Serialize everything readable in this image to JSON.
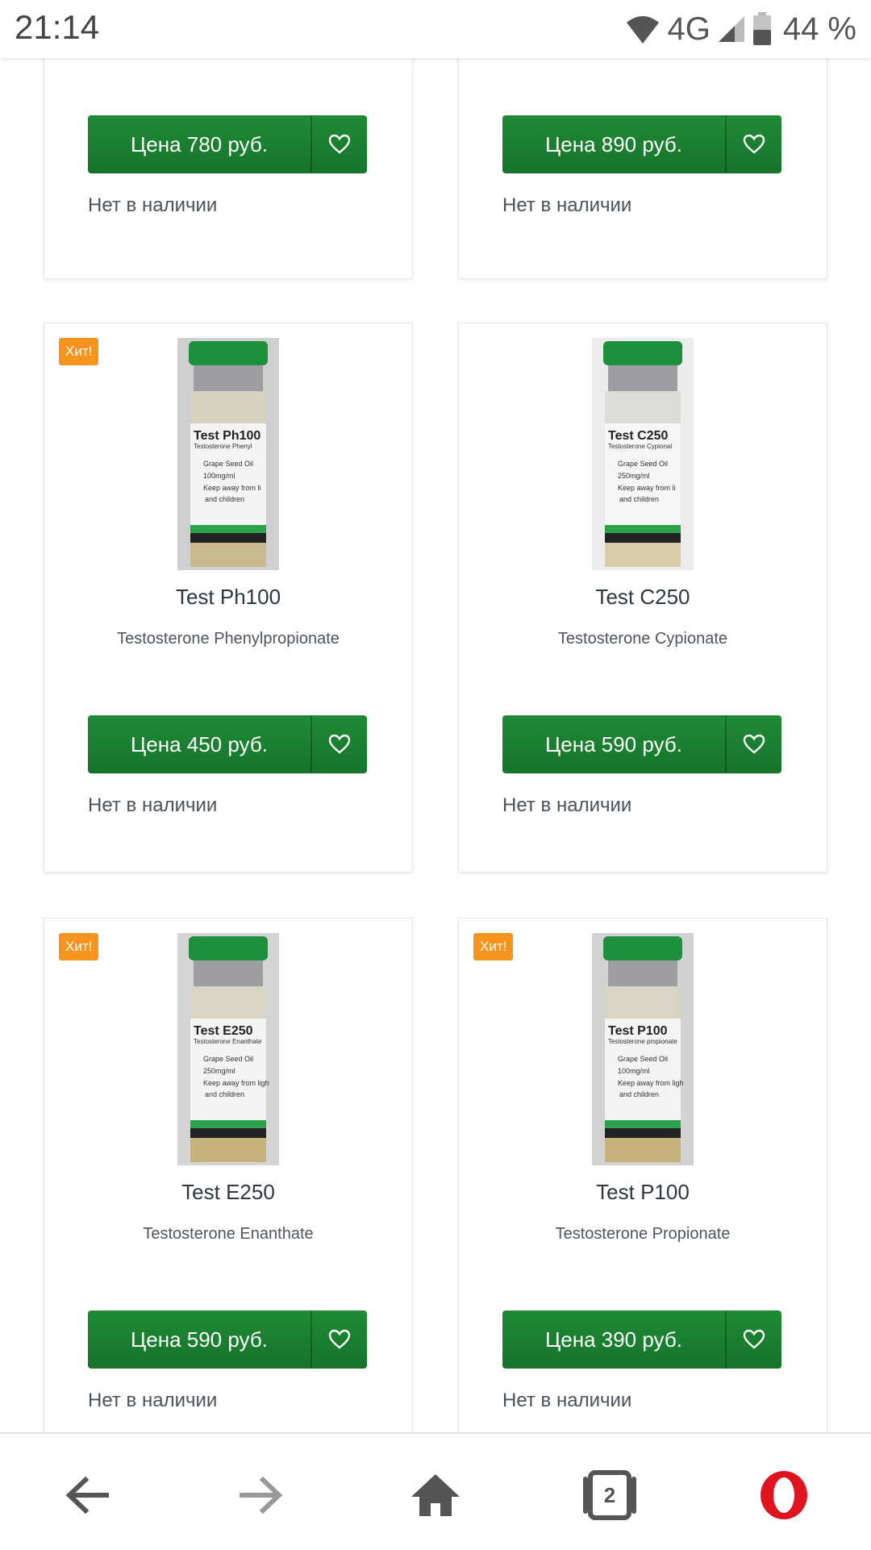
{
  "status_bar": {
    "time": "21:14",
    "network": "4G",
    "battery": "44 %"
  },
  "colors": {
    "price_green": "#1a7f31",
    "badge_orange": "#f7941d",
    "opera_red": "#e0141e"
  },
  "products": [
    {
      "badge": "",
      "name": "",
      "subtitle": "",
      "price": "Цена 780 руб.",
      "stock": "Нет в наличии"
    },
    {
      "badge": "",
      "name": "",
      "subtitle": "",
      "price": "Цена 890 руб.",
      "stock": "Нет в наличии"
    },
    {
      "badge": "Хит!",
      "name": "Test Ph100",
      "subtitle": "Testosterone Phenylpropionate",
      "price": "Цена 450 руб.",
      "stock": "Нет в наличии",
      "label": {
        "name": "Test Ph100",
        "sub": "Testosterone Phenyl",
        "l1": "Grape Seed Oil",
        "l2": "100mg/ml",
        "l3": "Keep away from li",
        "l4": "and children"
      }
    },
    {
      "badge": "",
      "name": "Test C250",
      "subtitle": "Testosterone Cypionate",
      "price": "Цена 590 руб.",
      "stock": "Нет в наличии",
      "label": {
        "name": "Test C250",
        "sub": "Testosterone Cypional",
        "l1": "Grape Seed Oil",
        "l2": "250mg/ml",
        "l3": "Keep away from li",
        "l4": "and children"
      }
    },
    {
      "badge": "Хит!",
      "name": "Test E250",
      "subtitle": "Testosterone Enanthate",
      "price": "Цена 590 руб.",
      "stock": "Нет в наличии",
      "label": {
        "name": "Test E250",
        "sub": "Testosterone Enanthate",
        "l1": "Grape Seed Oil",
        "l2": "250mg/ml",
        "l3": "Keep away from ligh",
        "l4": "and children"
      }
    },
    {
      "badge": "Хит!",
      "name": "Test P100",
      "subtitle": "Testosterone Propionate",
      "price": "Цена 390 руб.",
      "stock": "Нет в наличии",
      "label": {
        "name": "Test P100",
        "sub": "Testosterone propionate",
        "l1": "Grape Seed Oil",
        "l2": "100mg/ml",
        "l3": "Keep away from ligh",
        "l4": "and children"
      }
    }
  ],
  "bottom_nav": {
    "back": "back-arrow-icon",
    "forward": "forward-arrow-icon",
    "home": "home-icon",
    "tabs_count": "2",
    "menu": "opera-logo-icon"
  }
}
